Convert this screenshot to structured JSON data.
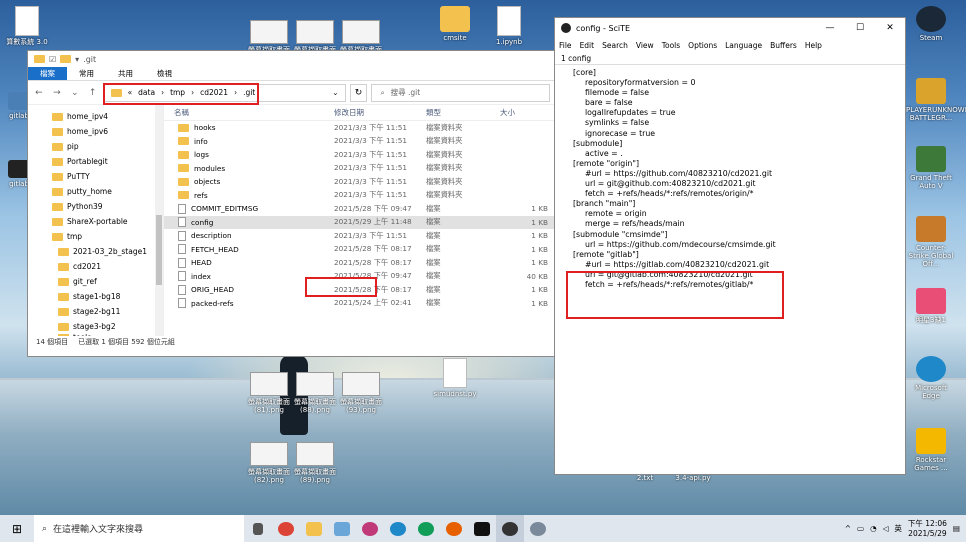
{
  "explorer": {
    "title": ".git",
    "ribbon_tabs": [
      "檔案",
      "常用",
      "共用",
      "檢視"
    ],
    "breadcrumb": [
      "«",
      "data",
      "tmp",
      "cd2021",
      ".git"
    ],
    "search_placeholder": "搜尋 .git",
    "nav_items": [
      "home_ipv4",
      "home_ipv6",
      "pip",
      "Portablegit",
      "PuTTY",
      "putty_home",
      "Python39",
      "ShareX-portable",
      "tmp",
      "2021-03_2b_stage1",
      "cd2021",
      "git_ref",
      "stage1-bg18",
      "stage2-bg11",
      "stage3-bg2",
      "tools"
    ],
    "columns": {
      "name": "名稱",
      "date": "修改日期",
      "type": "類型",
      "size": "大小"
    },
    "files": [
      {
        "name": "hooks",
        "date": "2021/3/3 下午 11:51",
        "type": "檔案資料夾",
        "size": "",
        "kind": "folder"
      },
      {
        "name": "info",
        "date": "2021/3/3 下午 11:51",
        "type": "檔案資料夾",
        "size": "",
        "kind": "folder"
      },
      {
        "name": "logs",
        "date": "2021/3/3 下午 11:51",
        "type": "檔案資料夾",
        "size": "",
        "kind": "folder"
      },
      {
        "name": "modules",
        "date": "2021/3/3 下午 11:51",
        "type": "檔案資料夾",
        "size": "",
        "kind": "folder"
      },
      {
        "name": "objects",
        "date": "2021/3/3 下午 11:51",
        "type": "檔案資料夾",
        "size": "",
        "kind": "folder"
      },
      {
        "name": "refs",
        "date": "2021/3/3 下午 11:51",
        "type": "檔案資料夾",
        "size": "",
        "kind": "folder"
      },
      {
        "name": "COMMIT_EDITMSG",
        "date": "2021/5/28 下午 09:47",
        "type": "檔案",
        "size": "1 KB",
        "kind": "file"
      },
      {
        "name": "config",
        "date": "2021/5/29 上午 11:48",
        "type": "檔案",
        "size": "1 KB",
        "kind": "file"
      },
      {
        "name": "description",
        "date": "2021/3/3 下午 11:51",
        "type": "檔案",
        "size": "1 KB",
        "kind": "file"
      },
      {
        "name": "FETCH_HEAD",
        "date": "2021/5/28 下午 08:17",
        "type": "檔案",
        "size": "1 KB",
        "kind": "file"
      },
      {
        "name": "HEAD",
        "date": "2021/5/28 下午 08:17",
        "type": "檔案",
        "size": "1 KB",
        "kind": "file"
      },
      {
        "name": "index",
        "date": "2021/5/28 下午 09:47",
        "type": "檔案",
        "size": "40 KB",
        "kind": "file"
      },
      {
        "name": "ORIG_HEAD",
        "date": "2021/5/28 下午 08:17",
        "type": "檔案",
        "size": "1 KB",
        "kind": "file"
      },
      {
        "name": "packed-refs",
        "date": "2021/5/24 上午 02:41",
        "type": "檔案",
        "size": "1 KB",
        "kind": "file"
      }
    ],
    "status": {
      "count": "14 個項目",
      "selection": "已選取 1 個項目  592 個位元組"
    }
  },
  "scite": {
    "title": "config - SciTE",
    "menu": [
      "File",
      "Edit",
      "Search",
      "View",
      "Tools",
      "Options",
      "Language",
      "Buffers",
      "Help"
    ],
    "tab": "1 config",
    "lines": [
      {
        "text": "[core]",
        "indent": false
      },
      {
        "text": "repositoryformatversion = 0",
        "indent": true
      },
      {
        "text": "filemode = false",
        "indent": true
      },
      {
        "text": "bare = false",
        "indent": true
      },
      {
        "text": "logallrefupdates = true",
        "indent": true
      },
      {
        "text": "symlinks = false",
        "indent": true
      },
      {
        "text": "ignorecase = true",
        "indent": true
      },
      {
        "text": "[submodule]",
        "indent": false
      },
      {
        "text": "active = .",
        "indent": true
      },
      {
        "text": "[remote \"origin\"]",
        "indent": false
      },
      {
        "text": "#url = https://github.com/40823210/cd2021.git",
        "indent": true
      },
      {
        "text": "url = git@github.com:40823210/cd2021.git",
        "indent": true
      },
      {
        "text": "fetch = +refs/heads/*:refs/remotes/origin/*",
        "indent": true
      },
      {
        "text": "[branch \"main\"]",
        "indent": false
      },
      {
        "text": "remote = origin",
        "indent": true
      },
      {
        "text": "merge = refs/heads/main",
        "indent": true
      },
      {
        "text": "[submodule \"cmsimde\"]",
        "indent": false
      },
      {
        "text": "url = https://github.com/mdecourse/cmsimde.git",
        "indent": true
      },
      {
        "text": "[remote \"gitlab\"]",
        "indent": false
      },
      {
        "text": "#url = https://gitlab.com/40823210/cd2021.git",
        "indent": true
      },
      {
        "text": "url = git@gitlab.com:40823210/cd2021.git",
        "indent": true
      },
      {
        "text": "fetch = +refs/heads/*:refs/remotes/gitlab/*",
        "indent": true
      }
    ]
  },
  "desktop": {
    "icons_left": [
      "算數系統 3.0",
      "gitlab",
      "gitlab"
    ],
    "icons_right": [
      "Steam",
      "PLAYERUNKNOWN'S BATTLEGR...",
      "Grand Theft Auto V",
      "Counter-Strike Global Off...",
      "明星3缺1",
      "Microsoft Edge",
      "Rockstar Games ..."
    ],
    "thumbs_top": [
      "螢幕擷取畫面 (86).png",
      "螢幕擷取畫面 (85).png",
      "螢幕擷取畫面 (84).png"
    ],
    "top_files": [
      "cmsite",
      "1.ipynb"
    ],
    "thumbs_mid": [
      "螢幕擷取畫面 (81).png",
      "螢幕擷取畫面 (88).png",
      "螢幕擷取畫面 (93).png"
    ],
    "thumbs_low": [
      "螢幕擷取畫面 (82).png",
      "螢幕擷取畫面 (89).png"
    ],
    "py_file": "simudnst.py",
    "bottom_files": [
      "2.txt",
      "3.4-api.py"
    ]
  },
  "taskbar": {
    "search_placeholder": "在這裡輸入文字來搜尋",
    "ime": "英",
    "time": "下午 12:06",
    "date": "2021/5/29"
  },
  "colors": {
    "highlight": "#e02020",
    "accent": "#1a6fc9",
    "folder": "#f2c14e"
  }
}
